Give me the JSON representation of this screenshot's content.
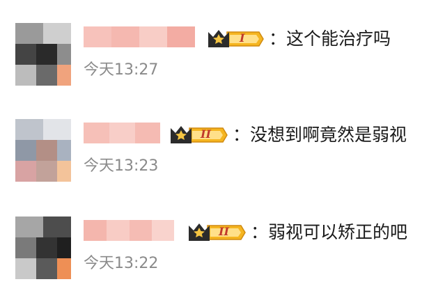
{
  "comments": [
    {
      "username": "",
      "badge": {
        "level": "I",
        "icon": "crown-icon",
        "color": "#f5b520"
      },
      "message": "：这个能治疗吗",
      "time": "今天13:27"
    },
    {
      "username": "",
      "badge": {
        "level": "II",
        "icon": "crown-icon",
        "color": "#f5b520"
      },
      "message": "：没想到啊竟然是弱视",
      "time": "今天13:23"
    },
    {
      "username": "",
      "badge": {
        "level": "II",
        "icon": "crown-icon",
        "color": "#f5b520"
      },
      "message": "：弱视可以矫正的吧",
      "time": "今天13:22"
    }
  ],
  "colors": {
    "name_blur": "#f2a8a0",
    "time_text": "#8a8a8a",
    "badge_gold": "#f5b520",
    "badge_level": "#c0392b"
  }
}
